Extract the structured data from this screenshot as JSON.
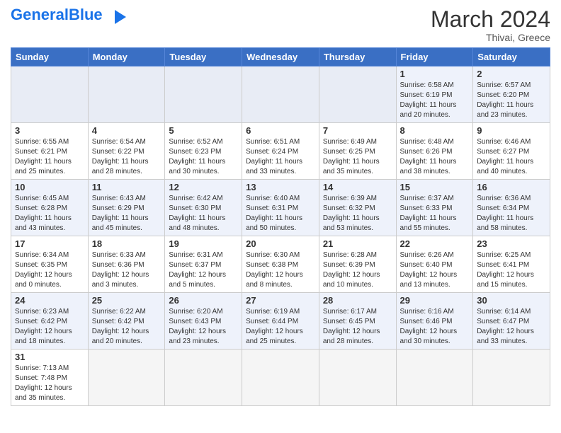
{
  "header": {
    "logo_text_normal": "General",
    "logo_text_blue": "Blue",
    "month_year": "March 2024",
    "location": "Thivai, Greece"
  },
  "weekdays": [
    "Sunday",
    "Monday",
    "Tuesday",
    "Wednesday",
    "Thursday",
    "Friday",
    "Saturday"
  ],
  "weeks": [
    [
      {
        "day": "",
        "info": ""
      },
      {
        "day": "",
        "info": ""
      },
      {
        "day": "",
        "info": ""
      },
      {
        "day": "",
        "info": ""
      },
      {
        "day": "",
        "info": ""
      },
      {
        "day": "1",
        "info": "Sunrise: 6:58 AM\nSunset: 6:19 PM\nDaylight: 11 hours and 20 minutes."
      },
      {
        "day": "2",
        "info": "Sunrise: 6:57 AM\nSunset: 6:20 PM\nDaylight: 11 hours and 23 minutes."
      }
    ],
    [
      {
        "day": "3",
        "info": "Sunrise: 6:55 AM\nSunset: 6:21 PM\nDaylight: 11 hours and 25 minutes."
      },
      {
        "day": "4",
        "info": "Sunrise: 6:54 AM\nSunset: 6:22 PM\nDaylight: 11 hours and 28 minutes."
      },
      {
        "day": "5",
        "info": "Sunrise: 6:52 AM\nSunset: 6:23 PM\nDaylight: 11 hours and 30 minutes."
      },
      {
        "day": "6",
        "info": "Sunrise: 6:51 AM\nSunset: 6:24 PM\nDaylight: 11 hours and 33 minutes."
      },
      {
        "day": "7",
        "info": "Sunrise: 6:49 AM\nSunset: 6:25 PM\nDaylight: 11 hours and 35 minutes."
      },
      {
        "day": "8",
        "info": "Sunrise: 6:48 AM\nSunset: 6:26 PM\nDaylight: 11 hours and 38 minutes."
      },
      {
        "day": "9",
        "info": "Sunrise: 6:46 AM\nSunset: 6:27 PM\nDaylight: 11 hours and 40 minutes."
      }
    ],
    [
      {
        "day": "10",
        "info": "Sunrise: 6:45 AM\nSunset: 6:28 PM\nDaylight: 11 hours and 43 minutes."
      },
      {
        "day": "11",
        "info": "Sunrise: 6:43 AM\nSunset: 6:29 PM\nDaylight: 11 hours and 45 minutes."
      },
      {
        "day": "12",
        "info": "Sunrise: 6:42 AM\nSunset: 6:30 PM\nDaylight: 11 hours and 48 minutes."
      },
      {
        "day": "13",
        "info": "Sunrise: 6:40 AM\nSunset: 6:31 PM\nDaylight: 11 hours and 50 minutes."
      },
      {
        "day": "14",
        "info": "Sunrise: 6:39 AM\nSunset: 6:32 PM\nDaylight: 11 hours and 53 minutes."
      },
      {
        "day": "15",
        "info": "Sunrise: 6:37 AM\nSunset: 6:33 PM\nDaylight: 11 hours and 55 minutes."
      },
      {
        "day": "16",
        "info": "Sunrise: 6:36 AM\nSunset: 6:34 PM\nDaylight: 11 hours and 58 minutes."
      }
    ],
    [
      {
        "day": "17",
        "info": "Sunrise: 6:34 AM\nSunset: 6:35 PM\nDaylight: 12 hours and 0 minutes."
      },
      {
        "day": "18",
        "info": "Sunrise: 6:33 AM\nSunset: 6:36 PM\nDaylight: 12 hours and 3 minutes."
      },
      {
        "day": "19",
        "info": "Sunrise: 6:31 AM\nSunset: 6:37 PM\nDaylight: 12 hours and 5 minutes."
      },
      {
        "day": "20",
        "info": "Sunrise: 6:30 AM\nSunset: 6:38 PM\nDaylight: 12 hours and 8 minutes."
      },
      {
        "day": "21",
        "info": "Sunrise: 6:28 AM\nSunset: 6:39 PM\nDaylight: 12 hours and 10 minutes."
      },
      {
        "day": "22",
        "info": "Sunrise: 6:26 AM\nSunset: 6:40 PM\nDaylight: 12 hours and 13 minutes."
      },
      {
        "day": "23",
        "info": "Sunrise: 6:25 AM\nSunset: 6:41 PM\nDaylight: 12 hours and 15 minutes."
      }
    ],
    [
      {
        "day": "24",
        "info": "Sunrise: 6:23 AM\nSunset: 6:42 PM\nDaylight: 12 hours and 18 minutes."
      },
      {
        "day": "25",
        "info": "Sunrise: 6:22 AM\nSunset: 6:42 PM\nDaylight: 12 hours and 20 minutes."
      },
      {
        "day": "26",
        "info": "Sunrise: 6:20 AM\nSunset: 6:43 PM\nDaylight: 12 hours and 23 minutes."
      },
      {
        "day": "27",
        "info": "Sunrise: 6:19 AM\nSunset: 6:44 PM\nDaylight: 12 hours and 25 minutes."
      },
      {
        "day": "28",
        "info": "Sunrise: 6:17 AM\nSunset: 6:45 PM\nDaylight: 12 hours and 28 minutes."
      },
      {
        "day": "29",
        "info": "Sunrise: 6:16 AM\nSunset: 6:46 PM\nDaylight: 12 hours and 30 minutes."
      },
      {
        "day": "30",
        "info": "Sunrise: 6:14 AM\nSunset: 6:47 PM\nDaylight: 12 hours and 33 minutes."
      }
    ],
    [
      {
        "day": "31",
        "info": "Sunrise: 7:13 AM\nSunset: 7:48 PM\nDaylight: 12 hours and 35 minutes."
      },
      {
        "day": "",
        "info": ""
      },
      {
        "day": "",
        "info": ""
      },
      {
        "day": "",
        "info": ""
      },
      {
        "day": "",
        "info": ""
      },
      {
        "day": "",
        "info": ""
      },
      {
        "day": "",
        "info": ""
      }
    ]
  ],
  "shaded_rows": [
    0,
    2,
    4
  ],
  "colors": {
    "header_bg": "#3a6fc4",
    "shaded_row": "#eef2fb",
    "border": "#cccccc"
  }
}
